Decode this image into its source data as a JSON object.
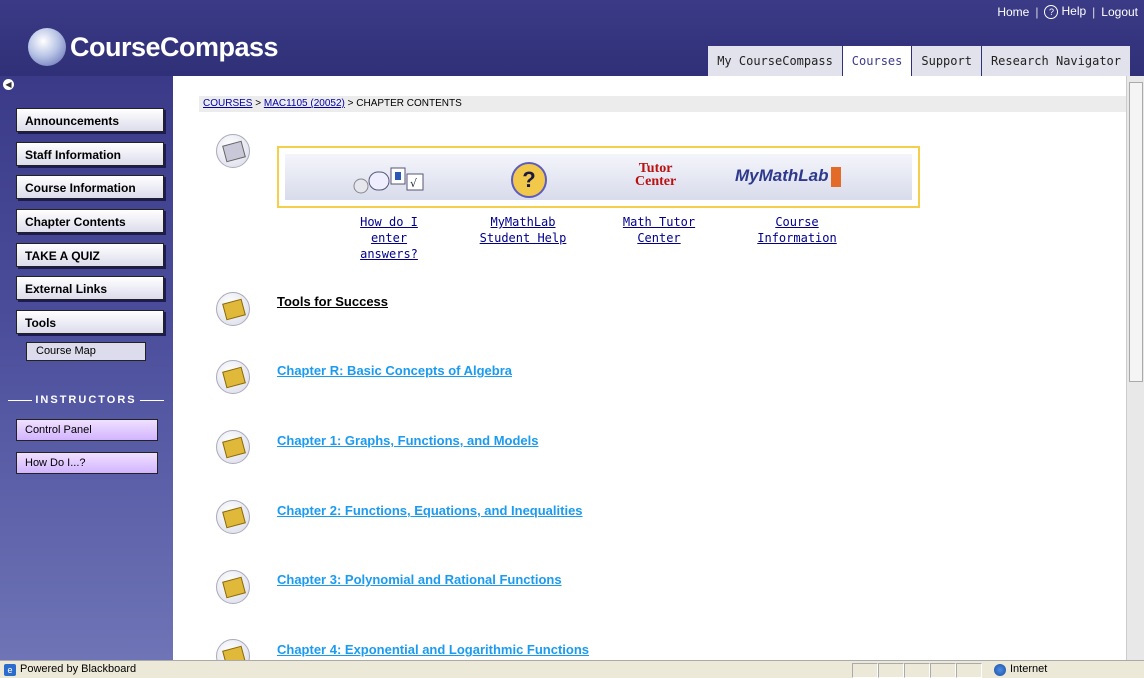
{
  "header": {
    "logo_text": "CourseCompass",
    "util_links": {
      "home": "Home",
      "help": "Help",
      "help_icon": "?",
      "logout": "Logout"
    },
    "tabs": [
      {
        "label": "My CourseCompass",
        "active": false
      },
      {
        "label": "Courses",
        "active": true
      },
      {
        "label": "Support",
        "active": false
      },
      {
        "label": "Research Navigator",
        "active": false
      }
    ]
  },
  "sidebar": {
    "collapse_icon": "◀",
    "items": [
      {
        "label": "Announcements"
      },
      {
        "label": "Staff Information"
      },
      {
        "label": "Course Information"
      },
      {
        "label": "Chapter Contents"
      },
      {
        "label": "TAKE A QUIZ"
      },
      {
        "label": "External Links"
      },
      {
        "label": "Tools"
      }
    ],
    "sub_item": "Course Map",
    "instructors_heading": "INSTRUCTORS",
    "instructor_items": [
      "Control Panel",
      "How Do I...?"
    ]
  },
  "breadcrumb": {
    "courses": "COURSES",
    "sep1": " > ",
    "course": "MAC1105 (20052)",
    "sep2": " > ",
    "current": "CHAPTER CONTENTS"
  },
  "banner": {
    "tutor_line1": "Tutor",
    "tutor_line2": "Center",
    "mml_logo": "MyMathLab",
    "help_glyph": "?",
    "links": [
      {
        "line1": "How do I enter",
        "line2": "answers?"
      },
      {
        "line1": "MyMathLab",
        "line2": "Student Help"
      },
      {
        "line1": "Math Tutor",
        "line2": "Center"
      },
      {
        "line1": "Course",
        "line2": "Information"
      }
    ]
  },
  "chapters": [
    "Tools for Success",
    "Chapter R: Basic Concepts of Algebra",
    "Chapter 1: Graphs, Functions, and Models",
    "Chapter 2: Functions, Equations, and Inequalities",
    "Chapter 3: Polynomial and Rational Functions",
    "Chapter 4: Exponential and Logarithmic Functions"
  ],
  "status": {
    "left_text": "Powered by Blackboard",
    "zone": "Internet"
  }
}
